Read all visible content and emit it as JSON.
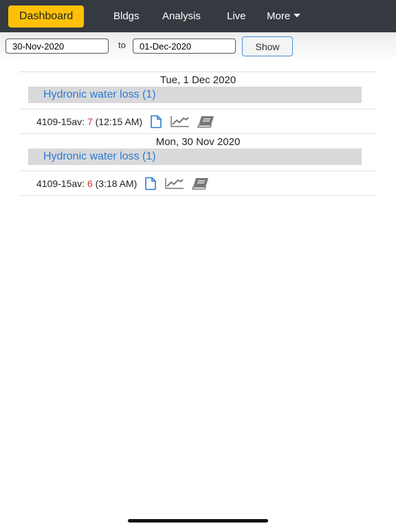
{
  "navbar": {
    "dashboard": "Dashboard",
    "bldgs": "Bldgs",
    "analysis": "Analysis",
    "live": "Live",
    "more": "More"
  },
  "filters": {
    "from_date": "30-Nov-2020",
    "to_label": "to",
    "to_date": "01-Dec-2020",
    "show_label": "Show"
  },
  "days": [
    {
      "date": "Tue, 1 Dec 2020",
      "category": "Hydronic water loss (1)",
      "alarm": {
        "building": "4109-15av:",
        "count": "7",
        "time": "(12:15 AM)"
      }
    },
    {
      "date": "Mon, 30 Nov 2020",
      "category": "Hydronic water loss (1)",
      "alarm": {
        "building": "4109-15av:",
        "count": "6",
        "time": "(3:18 AM)"
      }
    }
  ],
  "icons": {
    "report": "document-icon",
    "trend": "trend-chart-icon",
    "log": "book-icon"
  },
  "colors": {
    "navbar_bg": "#343a40",
    "active_tab": "#ffc107",
    "link_blue": "#2a7ad4",
    "alarm_red": "#d0332b",
    "category_bg": "#d9d9db"
  }
}
